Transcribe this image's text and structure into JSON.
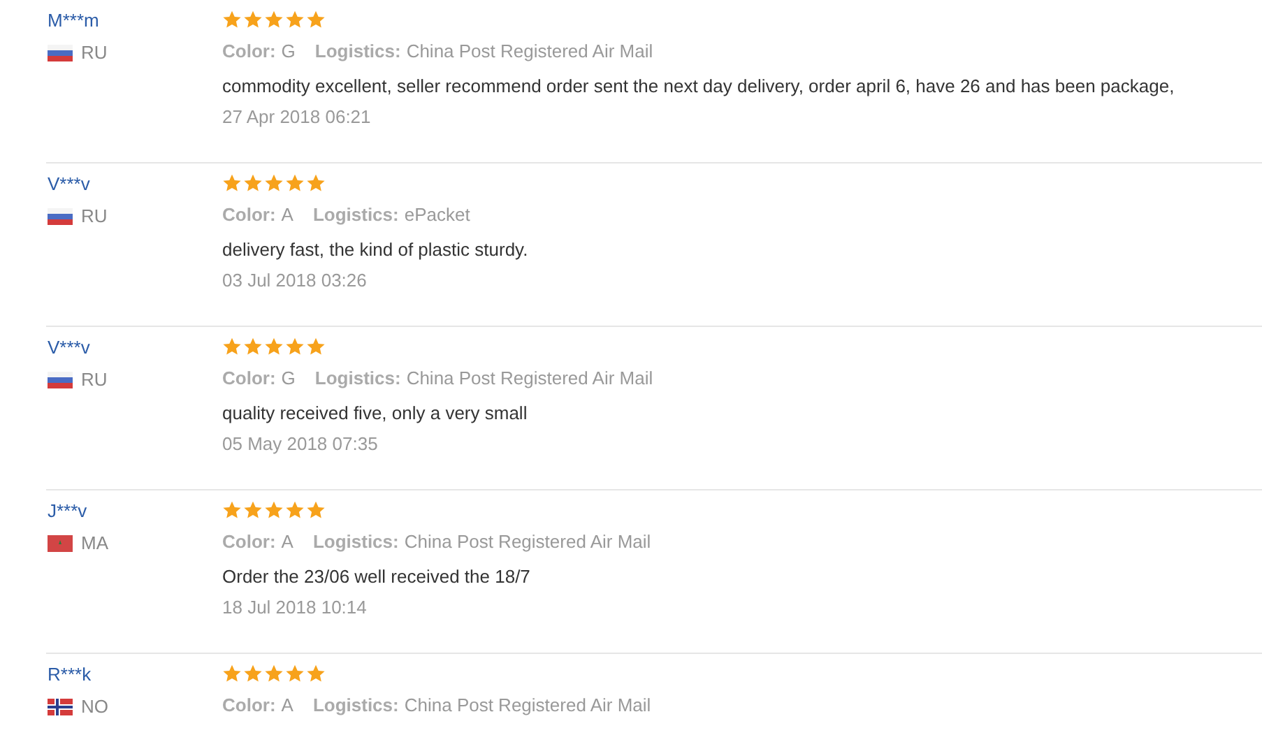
{
  "reviews": [
    {
      "user": "M***m",
      "kind": "ru",
      "country": "RU",
      "stars": 5,
      "color_label": "Color:",
      "color_option": "G",
      "logistics_label": "Logistics:",
      "logistics": "China Post Registered Air Mail",
      "text": "commodity excellent, seller recommend order sent the next day delivery, order april 6, have 26 and has been package,",
      "date": "27 Apr 2018 06:21"
    },
    {
      "user": "V***v",
      "kind": "ru",
      "country": "RU",
      "stars": 5,
      "color_label": "Color:",
      "color_option": "A",
      "logistics_label": "Logistics:",
      "logistics": "ePacket",
      "text": "delivery fast, the kind of plastic sturdy.",
      "date": "03 Jul 2018 03:26"
    },
    {
      "user": "V***v",
      "kind": "ru",
      "country": "RU",
      "stars": 5,
      "color_label": "Color:",
      "color_option": "G",
      "logistics_label": "Logistics:",
      "logistics": "China Post Registered Air Mail",
      "text": "quality received five, only a very small",
      "date": "05 May 2018 07:35"
    },
    {
      "user": "J***v",
      "kind": "ma",
      "country": "MA",
      "stars": 5,
      "color_label": "Color:",
      "color_option": "A",
      "logistics_label": "Logistics:",
      "logistics": "China Post Registered Air Mail",
      "text": "Order the 23/06 well received the 18/7",
      "date": "18 Jul 2018 10:14"
    },
    {
      "user": "R***k",
      "kind": "no",
      "country": "NO",
      "stars": 5,
      "color_label": "Color:",
      "color_option": "A",
      "logistics_label": "Logistics:",
      "logistics": "China Post Registered Air Mail"
    }
  ]
}
